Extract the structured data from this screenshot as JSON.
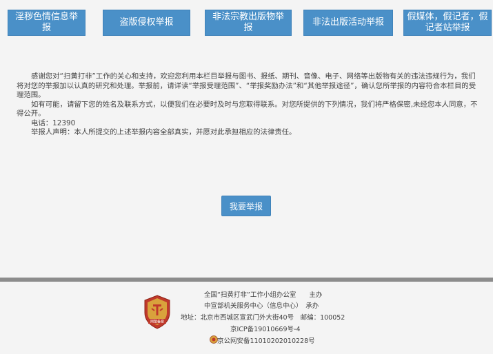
{
  "categories": [
    {
      "label": "淫秽色情信息举报"
    },
    {
      "label": "盗版侵权举报"
    },
    {
      "label": "非法宗教出版物举报"
    },
    {
      "label": "非法出版活动举报"
    },
    {
      "label": "假媒体，假记者，假记者站举报"
    }
  ],
  "intro": {
    "para1": "感谢您对“扫黄打非”工作的关心和支持，欢迎您利用本栏目举报与图书、报纸、期刊、音像、电子、网络等出版物有关的违法违规行为，我们将对您的举报加以认真的研究和处理。举报前，请详读“举报受理范围”、“举报奖励办法”和“其他举报途径”，确认您所举报的内容符合本栏目的受理范围。",
    "para2": "如有可能，请留下您的姓名及联系方式，以便我们在必要时及时与您取得联系。对您所提供的下列情况，我们将严格保密,未经您本人同意，不得公开。",
    "phone": "电话：12390",
    "declaration": "举报人声明：本人所提交的上述举报内容全部真实，并愿对此承担相应的法律责任。"
  },
  "report_button": {
    "label": "我要举报"
  },
  "footer": {
    "host": "全国“扫黄打非”工作小组办公室　　主办",
    "organizer": "中宣部机关服务中心（信息中心）　承办",
    "address": "地址：北京市西城区宣武门外大街40号　邮编：100052",
    "icp": "京ICP备19010669号-4",
    "police": "京公网安备11010202010228号",
    "badge_text": "网警备案"
  },
  "colors": {
    "accent": "#4a90c8",
    "divider": "#8c8c8c",
    "badge": "#c0392b"
  }
}
